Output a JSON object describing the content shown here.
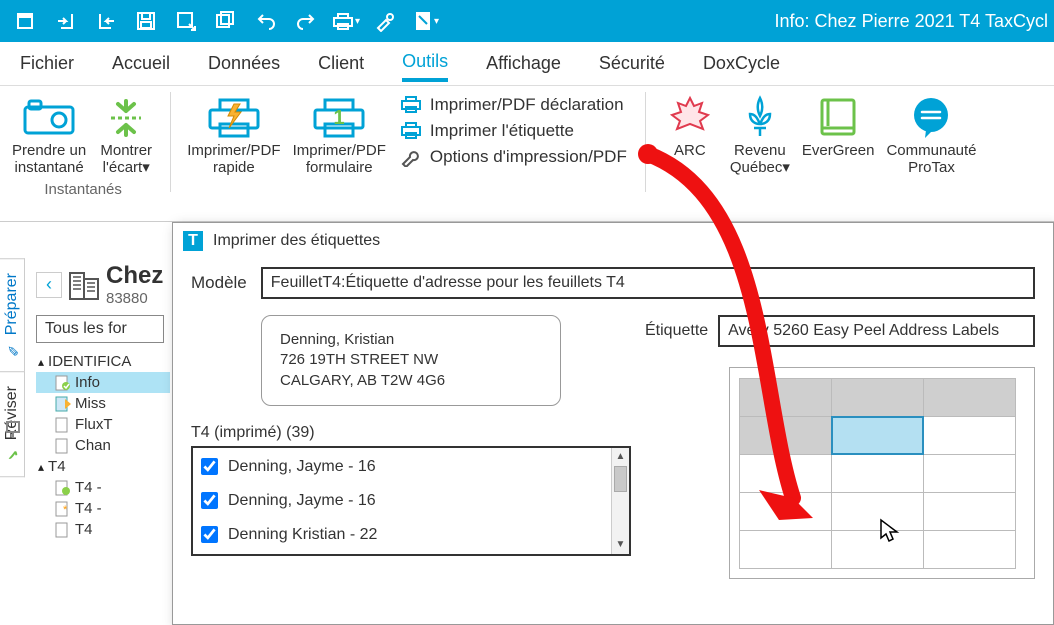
{
  "app_title": "Info: Chez Pierre 2021 T4 TaxCycl",
  "menubar": {
    "tabs": [
      "Fichier",
      "Accueil",
      "Données",
      "Client",
      "Outils",
      "Affichage",
      "Sécurité",
      "DoxCycle"
    ],
    "active_index": 4
  },
  "ribbon": {
    "camera": {
      "l1": "Prendre un",
      "l2": "instantané"
    },
    "ecart": {
      "l1": "Montrer",
      "l2": "l'écart▾"
    },
    "group_label": "Instantanés",
    "pdf_rapide": {
      "l1": "Imprimer/PDF",
      "l2": "rapide"
    },
    "pdf_form": {
      "l1": "Imprimer/PDF",
      "l2": "formulaire"
    },
    "row1": "Imprimer/PDF déclaration",
    "row2": "Imprimer l'étiquette",
    "row3": "Options d'impression/PDF",
    "arc": "ARC",
    "rq": {
      "l1": "Revenu",
      "l2": "Québec▾"
    },
    "eg": "EverGreen",
    "ct": {
      "l1": "Communauté",
      "l2": "ProTax"
    }
  },
  "left": {
    "chev": "‹",
    "title": "Chez",
    "sub": "83880",
    "all": "Tous les for",
    "tree": {
      "n1": "IDENTIFICA",
      "n1a": "Info",
      "n1b": "Miss",
      "n1c": "FluxT",
      "n1d": "Chan",
      "n2": "T4",
      "n2a": "T4 -",
      "n2b": "T4 -",
      "n2c": "T4"
    }
  },
  "vtabs": {
    "prep": "Préparer",
    "rev": "Réviser"
  },
  "dialog": {
    "title": "Imprimer des étiquettes",
    "modele_label": "Modèle",
    "modele_value": "FeuilletT4:Étiquette d'adresse pour les feuillets T4",
    "address": {
      "l1": "Denning, Kristian",
      "l2": "726 19TH STREET NW",
      "l3": "CALGARY, AB T2W 4G6"
    },
    "list_header": "T4 (imprimé) (39)",
    "items": [
      {
        "label": "Denning, Jayme - 16",
        "checked": true
      },
      {
        "label": "Denning, Jayme - 16",
        "checked": true
      },
      {
        "label": "Denning  Kristian - 22",
        "checked": true
      }
    ],
    "etiq_label": "Étiquette",
    "etiq_value": "Avery 5260 Easy Peel Address Labels",
    "sheet": {
      "cols": 3,
      "rows": 5,
      "used": 4,
      "selected_index": 4
    }
  }
}
